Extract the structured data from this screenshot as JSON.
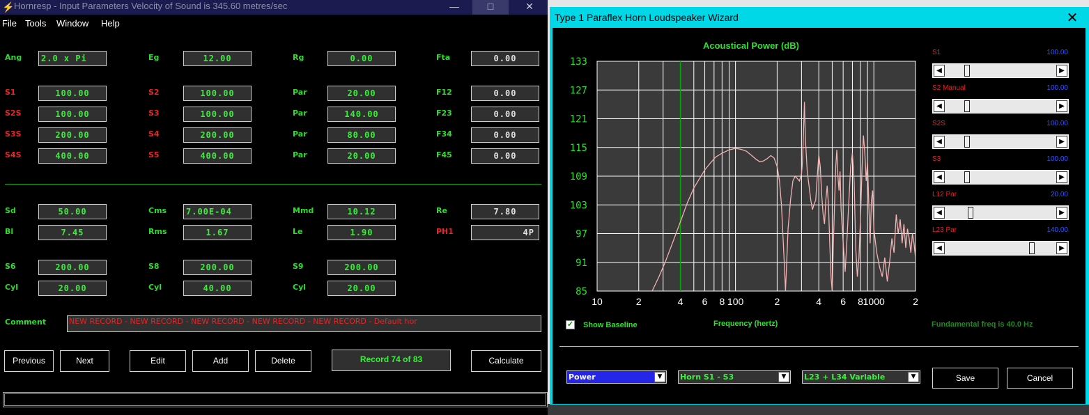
{
  "main_window": {
    "title": "Hornresp - Input Parameters   Velocity of Sound is 345.60 metres/sec",
    "controls": {
      "minimize": "—",
      "maximize": "□",
      "close": "✕"
    },
    "menu": [
      "File",
      "Tools",
      "Window",
      "Help"
    ],
    "top_params": [
      {
        "label": "Ang",
        "value": "2.0 x Pi"
      },
      {
        "label": "Eg",
        "value": "12.00"
      },
      {
        "label": "Rg",
        "value": "0.00"
      },
      {
        "label": "Fta",
        "value": "0.00"
      }
    ],
    "horn_col1": [
      {
        "label": "S1",
        "value": "100.00"
      },
      {
        "label": "S2S",
        "value": "100.00"
      },
      {
        "label": "S3S",
        "value": "200.00"
      },
      {
        "label": "S4S",
        "value": "400.00"
      }
    ],
    "horn_col2": [
      {
        "label": "S2",
        "value": "100.00"
      },
      {
        "label": "S3",
        "value": "100.00"
      },
      {
        "label": "S4",
        "value": "200.00"
      },
      {
        "label": "S5",
        "value": "400.00"
      }
    ],
    "horn_col3": [
      {
        "label": "Par",
        "value": "20.00"
      },
      {
        "label": "Par",
        "value": "140.00"
      },
      {
        "label": "Par",
        "value": "80.00"
      },
      {
        "label": "Par",
        "value": "20.00"
      }
    ],
    "horn_col4": [
      {
        "label": "F12",
        "value": "0.00"
      },
      {
        "label": "F23",
        "value": "0.00"
      },
      {
        "label": "F34",
        "value": "0.00"
      },
      {
        "label": "F45",
        "value": "0.00"
      }
    ],
    "driver": [
      {
        "label": "Sd",
        "value": "50.00"
      },
      {
        "label": "Cms",
        "value": "7.00E-04"
      },
      {
        "label": "Mmd",
        "value": "10.12"
      },
      {
        "label": "Re",
        "value": "7.80"
      },
      {
        "label": "Bl",
        "value": "7.45"
      },
      {
        "label": "Rms",
        "value": "1.67"
      },
      {
        "label": "Le",
        "value": "1.90"
      },
      {
        "label": "PH1",
        "value": "4P"
      }
    ],
    "chambers": [
      {
        "label": "S6",
        "value": "200.00"
      },
      {
        "label": "S8",
        "value": "200.00"
      },
      {
        "label": "S9",
        "value": "200.00"
      },
      {
        "label": "Cyl",
        "value": "20.00"
      },
      {
        "label": "Cyl",
        "value": "40.00"
      },
      {
        "label": "Cyl",
        "value": "20.00"
      }
    ],
    "comment_label": "Comment",
    "comment_value": "NEW RECORD - NEW RECORD - NEW RECORD - NEW RECORD - NEW RECORD - Default hor",
    "buttons": {
      "previous": "Previous",
      "next": "Next",
      "edit": "Edit",
      "add": "Add",
      "delete": "Delete",
      "calculate": "Calculate"
    },
    "record": "Record 74 of 83"
  },
  "wizard": {
    "title": "Type 1 Paraflex Horn Loudspeaker Wizard",
    "close": "✕",
    "chart_title": "Acoustical Power (dB)",
    "x_axis_label": "Frequency (hertz)",
    "show_baseline": "Show Baseline",
    "show_baseline_checked": true,
    "fundamental": "Fundamental freq is 40.0 Hz",
    "sliders": [
      {
        "label": "S1",
        "value": "100.00",
        "position": 0.18
      },
      {
        "label": "S2 Manual",
        "value": "100.00",
        "position": 0.18
      },
      {
        "label": "S2S",
        "value": "100.00",
        "position": 0.18
      },
      {
        "label": "S3",
        "value": "100.00",
        "position": 0.18
      },
      {
        "label": "L12 Par",
        "value": "20.00",
        "position": 0.21
      },
      {
        "label": "L23 Par",
        "value": "140.00",
        "position": 0.8
      }
    ],
    "dropdowns": [
      "Power",
      "Horn S1 - S3",
      "L23 + L34 Variable"
    ],
    "save_button": "Save",
    "cancel_button": "Cancel",
    "colors": {
      "curve": "#f2b3b3",
      "baseline": "#00aa00",
      "grid": "#ffffff",
      "plot_bg": "#3a3a3a"
    }
  },
  "chart_data": {
    "type": "line",
    "title": "Acoustical Power (dB)",
    "xlabel": "Frequency (hertz)",
    "ylabel": "",
    "x_scale": "log",
    "xlim": [
      10,
      2000
    ],
    "ylim": [
      85,
      133
    ],
    "yticks": [
      "133",
      "127",
      "121",
      "115",
      "109",
      "103",
      "97",
      "91",
      "85"
    ],
    "xticks": [
      "10",
      "2",
      "4",
      "6",
      "8",
      "100",
      "2",
      "4",
      "6",
      "8",
      "1000",
      "2"
    ],
    "baseline_x": 40,
    "series": [
      {
        "x": [
          25,
          28,
          31,
          35,
          40,
          45,
          50,
          55,
          60,
          66,
          72,
          80,
          90,
          100,
          110,
          120,
          130,
          140,
          150,
          160,
          170,
          180,
          190,
          200,
          208,
          215,
          220,
          225,
          230,
          240,
          250,
          260,
          270,
          280,
          290,
          300,
          305,
          310,
          315,
          320,
          330,
          350,
          360,
          370,
          380,
          390,
          400,
          410,
          420,
          430,
          440,
          450,
          460,
          470,
          480,
          490,
          500,
          510,
          520,
          530,
          540,
          550,
          560,
          570,
          580,
          600,
          620,
          640,
          660,
          680,
          700,
          720,
          740,
          760,
          780,
          800,
          820,
          840,
          860,
          880,
          900,
          920,
          940,
          960,
          980,
          1000,
          1050,
          1100,
          1150,
          1200,
          1250,
          1300,
          1350,
          1400,
          1450,
          1500,
          1550,
          1600,
          1650,
          1700,
          1750,
          1800,
          1850,
          1900,
          1950,
          2000
        ],
        "y": [
          85,
          88,
          91,
          95,
          99.5,
          103.5,
          106.5,
          108.5,
          110.3,
          111.8,
          113,
          113.8,
          114.5,
          114.8,
          114.6,
          114.2,
          113.4,
          112.6,
          112,
          112.2,
          112.7,
          113.3,
          112.8,
          111,
          108,
          103,
          97,
          91,
          85,
          98,
          104,
          108,
          109,
          108.5,
          108,
          109.5,
          112,
          118,
          124.5,
          117,
          110,
          104,
          102,
          103.2,
          104,
          109,
          113.5,
          111,
          105,
          101,
          99,
          104,
          107,
          103,
          95,
          88,
          85,
          95,
          103,
          111,
          114.5,
          109,
          106,
          110,
          102,
          95,
          89,
          96,
          104,
          111,
          113.8,
          108,
          94,
          88,
          92,
          100,
          110,
          117.5,
          114,
          108,
          112,
          103,
          95,
          104,
          106,
          98,
          93,
          90,
          88,
          92,
          87,
          91,
          96,
          93,
          101,
          97,
          100,
          95,
          99,
          94,
          98,
          96,
          93,
          97,
          95,
          92
        ]
      }
    ]
  }
}
